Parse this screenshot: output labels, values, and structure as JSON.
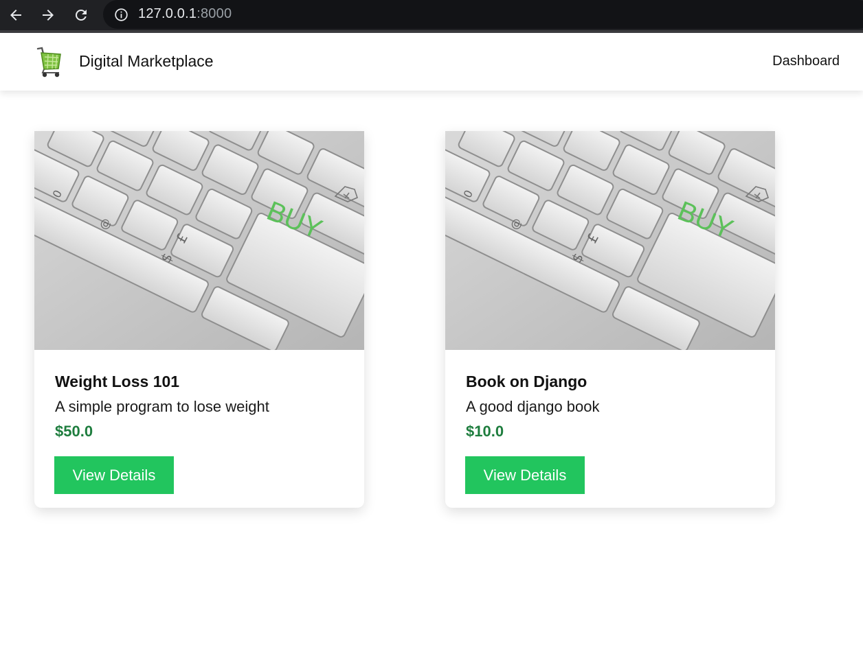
{
  "browser": {
    "url_host": "127.0.0.1",
    "url_port": ":8000",
    "icons": [
      "back-arrow-icon",
      "forward-arrow-icon",
      "reload-icon",
      "info-icon"
    ]
  },
  "navbar": {
    "brand": "Digital Marketplace",
    "logo_icon": "shopping-cart-icon",
    "links": [
      "Dashboard"
    ]
  },
  "products": [
    {
      "title": "Weight Loss 101",
      "description": "A simple program to lose weight",
      "price": "$50.0",
      "button_label": "View Details",
      "image": "keyboard-buy-key-photo"
    },
    {
      "title": "Book on Django",
      "description": "A good django book",
      "price": "$10.0",
      "button_label": "View Details",
      "image": "keyboard-buy-key-photo"
    }
  ],
  "colors": {
    "button_bg": "#22c55e",
    "price": "#1e7d3e",
    "browser_bar": "#202124",
    "buy_key_text": "#5cc15a"
  },
  "image_text": {
    "buy_key": "BUY"
  }
}
